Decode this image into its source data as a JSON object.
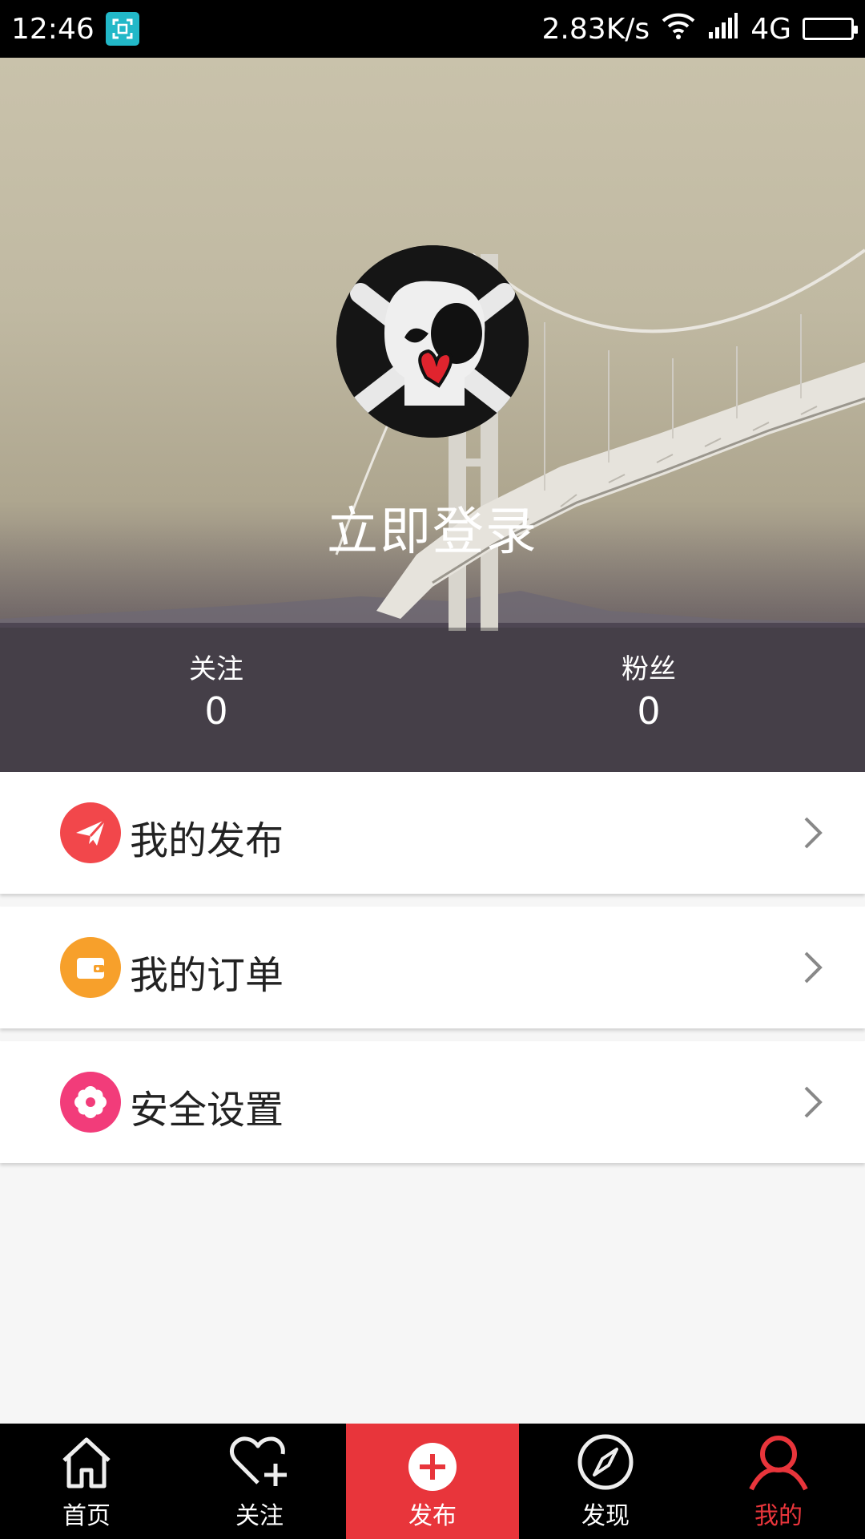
{
  "status_bar": {
    "time": "12:46",
    "network_speed": "2.83K/s",
    "network_type": "4G",
    "icons": [
      "screenshot-icon",
      "wifi-icon",
      "signal-icon",
      "battery-icon"
    ]
  },
  "header": {
    "login_text": "立即登录",
    "stats": [
      {
        "label": "关注",
        "value": "0"
      },
      {
        "label": "粉丝",
        "value": "0"
      }
    ]
  },
  "menu": [
    {
      "label": "我的发布",
      "icon": "paper-plane-icon",
      "color": "#f2474b"
    },
    {
      "label": "我的订单",
      "icon": "wallet-icon",
      "color": "#f7a02b"
    },
    {
      "label": "安全设置",
      "icon": "flower-gear-icon",
      "color": "#f23c7a"
    }
  ],
  "bottom_nav": [
    {
      "label": "首页",
      "icon": "home-icon"
    },
    {
      "label": "关注",
      "icon": "heart-plus-icon"
    },
    {
      "label": "发布",
      "icon": "plus-circle-icon"
    },
    {
      "label": "发现",
      "icon": "compass-icon"
    },
    {
      "label": "我的",
      "icon": "user-icon",
      "active": true
    }
  ],
  "colors": {
    "accent": "#e8353b",
    "background": "#f6f6f6"
  }
}
